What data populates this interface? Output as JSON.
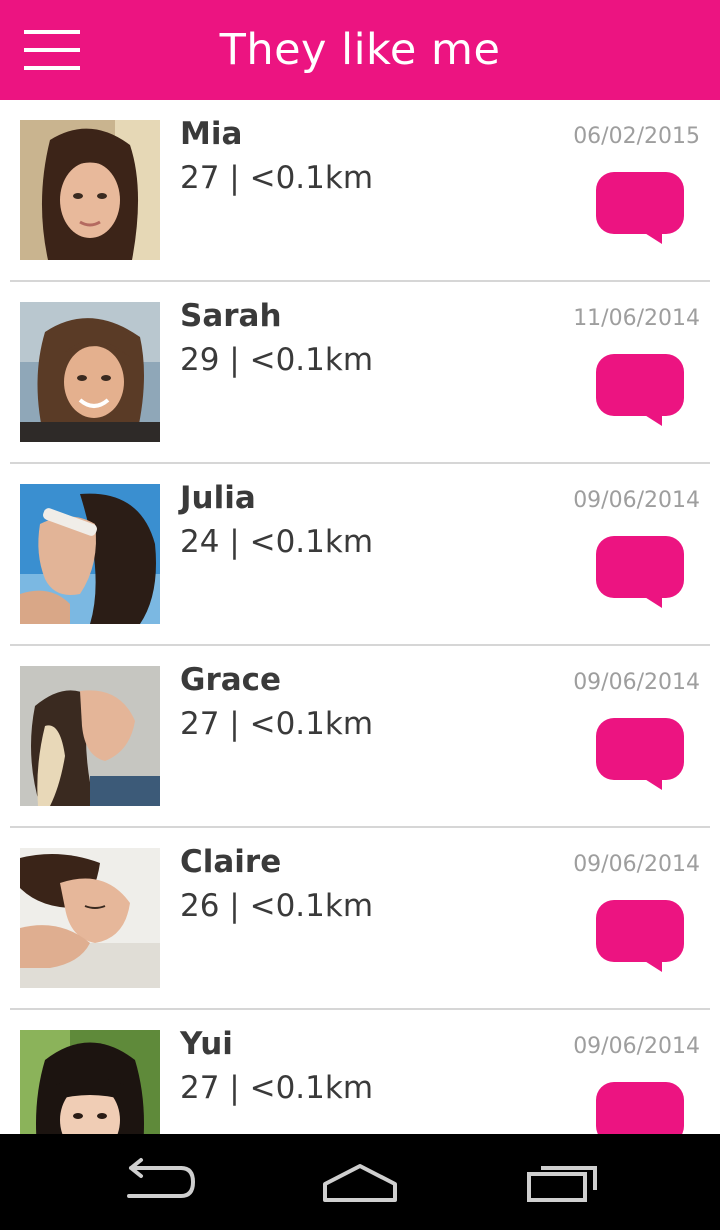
{
  "header": {
    "title": "They like me",
    "menu_icon": "hamburger-menu-icon"
  },
  "accent_color": "#ec1481",
  "users": [
    {
      "name": "Mia",
      "meta": "27 | <0.1km",
      "date": "06/02/2015"
    },
    {
      "name": "Sarah",
      "meta": "29 | <0.1km",
      "date": "11/06/2014"
    },
    {
      "name": "Julia",
      "meta": "24 | <0.1km",
      "date": "09/06/2014"
    },
    {
      "name": "Grace",
      "meta": "27 | <0.1km",
      "date": "09/06/2014"
    },
    {
      "name": "Claire",
      "meta": "26 | <0.1km",
      "date": "09/06/2014"
    },
    {
      "name": "Yui",
      "meta": "27 | <0.1km",
      "date": "09/06/2014"
    }
  ],
  "navbar": {
    "icons": [
      "back-icon",
      "home-icon",
      "recent-apps-icon"
    ]
  }
}
